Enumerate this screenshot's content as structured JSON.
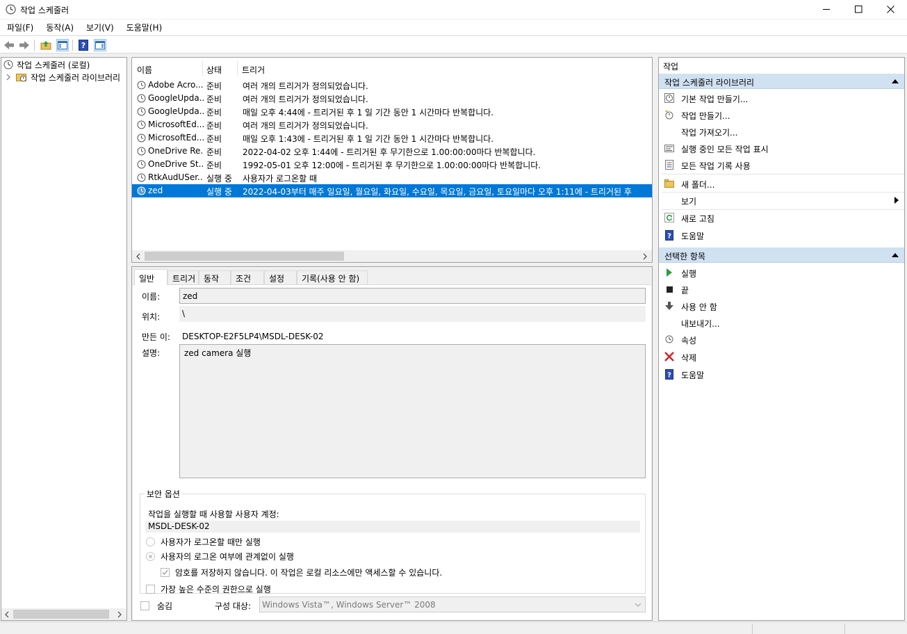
{
  "window": {
    "title": "작업 스케줄러",
    "minimize_icon": "minimize-icon",
    "maximize_icon": "maximize-icon",
    "close_icon": "close-icon"
  },
  "menu": [
    "파일(F)",
    "동작(A)",
    "보기(V)",
    "도움말(H)"
  ],
  "toolbar": {
    "icons": [
      "back-arrow-icon",
      "forward-arrow-icon",
      "up-folder-icon",
      "show-hide-console-tree-icon",
      "help-icon",
      "show-hide-action-pane-icon"
    ]
  },
  "tree": {
    "root_label": "작업 스케줄러 (로컬)",
    "child_label": "작업 스케줄러 라이브러리"
  },
  "task_list": {
    "columns": [
      "이름",
      "상태",
      "트리거"
    ],
    "rows": [
      {
        "name": "Adobe Acro...",
        "status": "준비",
        "trigger": "여러 개의 트리거가 정의되었습니다."
      },
      {
        "name": "GoogleUpda...",
        "status": "준비",
        "trigger": "여러 개의 트리거가 정의되었습니다."
      },
      {
        "name": "GoogleUpda...",
        "status": "준비",
        "trigger": "매일 오후 4:44에 - 트리거된 후 1 일 기간 동안 1 시간마다 반복합니다."
      },
      {
        "name": "MicrosoftEd...",
        "status": "준비",
        "trigger": "여러 개의 트리거가 정의되었습니다."
      },
      {
        "name": "MicrosoftEd...",
        "status": "준비",
        "trigger": "매일 오후 1:43에 - 트리거된 후 1 일 기간 동안 1 시간마다 반복합니다."
      },
      {
        "name": "OneDrive Re...",
        "status": "준비",
        "trigger": "2022-04-02 오후 1:44에 - 트리거된 후 무기한으로 1.00:00:00마다 반복합니다."
      },
      {
        "name": "OneDrive St...",
        "status": "준비",
        "trigger": "1992-05-01 오후 12:00에 - 트리거된 후 무기한으로 1.00:00:00마다 반복합니다."
      },
      {
        "name": "RtkAudUSer...",
        "status": "실행 중",
        "trigger": "사용자가 로그온할 때"
      },
      {
        "name": "zed",
        "status": "실행 중",
        "trigger": "2022-04-03부터 매주 일요일, 월요일, 화요일, 수요일, 목요일, 금요일, 토요일마다 오후 1:11에 - 트리거된 후"
      }
    ],
    "selected_index": 8
  },
  "detail": {
    "tabs": [
      "일반",
      "트리거",
      "동작",
      "조건",
      "설정",
      "기록(사용 안 함)"
    ],
    "active_tab": 0,
    "name_label": "이름:",
    "name_value": "zed",
    "location_label": "위치:",
    "location_value": "\\",
    "author_label": "만든 이:",
    "author_value": "DESKTOP-E2F5LP4\\MSDL-DESK-02",
    "description_label": "설명:",
    "description_value": "zed camera 실행",
    "security": {
      "legend": "보안 옵션",
      "account_label": "작업을 실행할 때 사용할 사용자 계정:",
      "account_value": "MSDL-DESK-02",
      "radio_logon_only": "사용자가 로그온할 때만 실행",
      "radio_whether_logged": "사용자의 로그온 여부에 관계없이 실행",
      "radio_selected": "whether_logged",
      "check_no_password": "암호를 저장하지 않습니다. 이 작업은 로컬 리소스에만 액세스할 수 있습니다.",
      "check_no_password_checked": true,
      "check_highest": "가장 높은 수준의 권한으로 실행",
      "check_highest_checked": false
    },
    "hidden_label": "숨김",
    "hidden_checked": false,
    "configure_label": "구성 대상:",
    "configure_value": "Windows Vista™, Windows Server™ 2008"
  },
  "actions": {
    "title": "작업",
    "group1": {
      "label": "작업 스케줄러 라이브러리",
      "items": [
        {
          "label": "기본 작업 만들기...",
          "icon": "create-basic-task-icon"
        },
        {
          "label": "작업 만들기...",
          "icon": "create-task-icon"
        },
        {
          "label": "작업 가져오기...",
          "icon": ""
        },
        {
          "label": "실행 중인 모든 작업 표시",
          "icon": "running-tasks-icon"
        },
        {
          "label": "모든 작업 기록 사용",
          "icon": "task-history-icon"
        },
        {
          "label": "새 폴더...",
          "icon": "new-folder-icon"
        },
        {
          "label": "보기",
          "icon": ""
        },
        {
          "label": "새로 고침",
          "icon": "refresh-icon"
        },
        {
          "label": "도움말",
          "icon": "help-icon"
        }
      ]
    },
    "group2": {
      "label": "선택한 항목",
      "items": [
        {
          "label": "실행",
          "icon": "run-icon"
        },
        {
          "label": "끝",
          "icon": "end-icon"
        },
        {
          "label": "사용 안 함",
          "icon": "disable-icon"
        },
        {
          "label": "내보내기...",
          "icon": ""
        },
        {
          "label": "속성",
          "icon": "properties-icon"
        },
        {
          "label": "삭제",
          "icon": "delete-icon"
        },
        {
          "label": "도움말",
          "icon": "help-icon"
        }
      ]
    }
  }
}
